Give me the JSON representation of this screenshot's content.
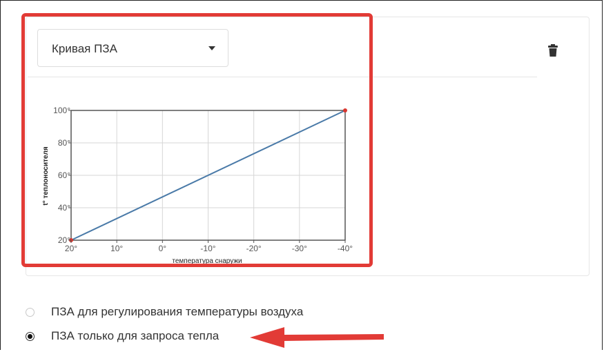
{
  "select": {
    "value": "Кривая ПЗА"
  },
  "chart_data": {
    "type": "line",
    "title": "",
    "xlabel": "температура снаружи",
    "ylabel": "t° теплоносителя",
    "x_tick_labels": [
      "20°",
      "10°",
      "0°",
      "-10°",
      "-20°",
      "-30°",
      "-40°"
    ],
    "y_tick_labels": [
      "20°",
      "40°",
      "60°",
      "80°",
      "100°"
    ],
    "xlim": [
      20,
      -40
    ],
    "ylim": [
      20,
      100
    ],
    "grid": true,
    "series": [
      {
        "x": [
          20,
          -40
        ],
        "y": [
          20,
          100
        ],
        "color": "#4a7aa8"
      }
    ],
    "point_color": "#d9362f"
  },
  "radio_options": [
    {
      "label": "ПЗА для регулирования температуры воздуха",
      "checked": false
    },
    {
      "label": "ПЗА только для запроса тепла",
      "checked": true
    }
  ],
  "colors": {
    "highlight": "#e23b36",
    "arrow": "#e23b36"
  },
  "icons": {
    "delete": "trash-icon",
    "dropdown": "caret-down-icon"
  }
}
